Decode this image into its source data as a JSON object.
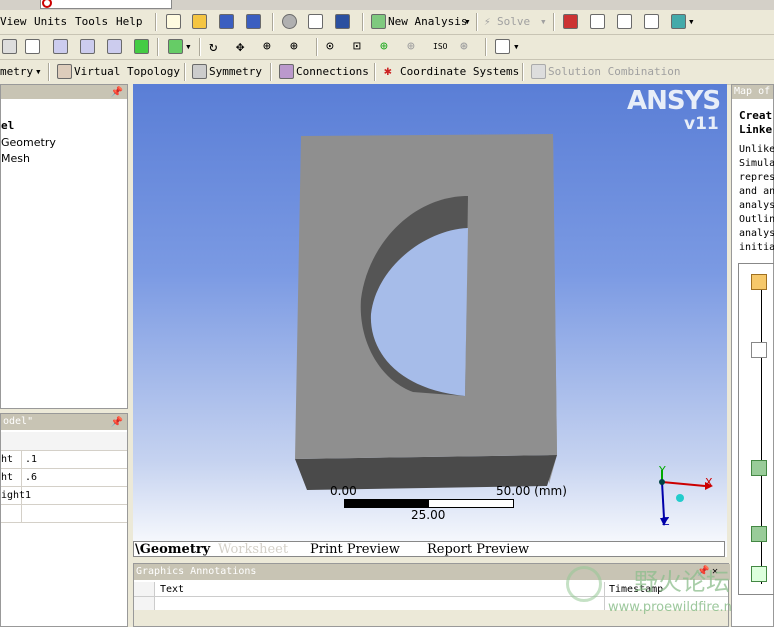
{
  "menubar": {
    "items": [
      "View",
      "Units",
      "Tools",
      "Help"
    ],
    "new_analysis": "New Analysis",
    "solve": "Solve"
  },
  "toolbar3": {
    "geometry": "metry",
    "virtual_topology": "Virtual Topology",
    "symmetry": "Symmetry",
    "connections": "Connections",
    "coordinate_systems": "Coordinate Systems",
    "solution_combination": "Solution Combination"
  },
  "tree": {
    "items": [
      "el",
      "Geometry",
      "Mesh"
    ]
  },
  "details": {
    "title": "odel\"",
    "rows": [
      {
        "key": "ht",
        "value": ".1"
      },
      {
        "key": "ht",
        "value": ".6"
      },
      {
        "key": "ight",
        "value": "1"
      },
      {
        "key": "",
        "value": ""
      }
    ]
  },
  "viewport": {
    "logo": "ANSYS",
    "version": "v11",
    "scale_start": "0.00",
    "scale_end": "50.00 (mm)",
    "scale_mid": "25.00",
    "axis_x": "X",
    "axis_y": "Y",
    "axis_z": "Z"
  },
  "view_tabs": [
    "\\Geometry",
    "Worksheet",
    "Print Preview",
    "Report Preview"
  ],
  "annotations": {
    "title": "Graphics Annotations",
    "col_text": "Text",
    "col_timestamp": "Timestamp"
  },
  "right_panel": {
    "title": "Map of",
    "heading1": "Creat",
    "heading2": "Linke",
    "lines": [
      "Unlike",
      "Simula",
      "repres",
      "and an",
      "analys",
      "Outlin",
      "analys",
      "initia"
    ]
  },
  "watermark": {
    "text": "野火论坛",
    "url": "www.proewildfire.n"
  }
}
